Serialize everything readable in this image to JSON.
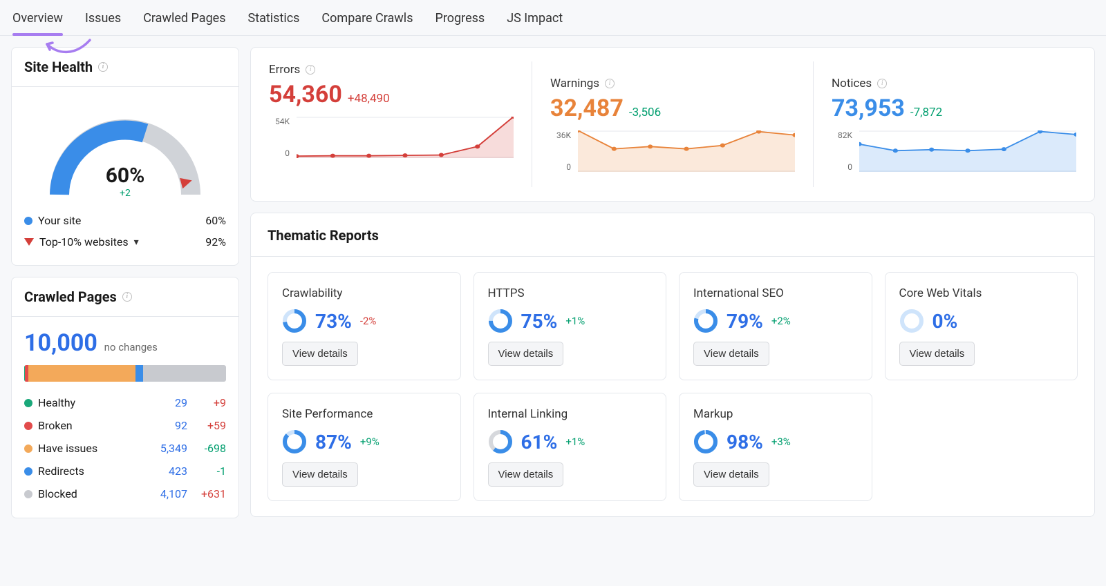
{
  "tabs": {
    "items": [
      {
        "label": "Overview",
        "active": true
      },
      {
        "label": "Issues"
      },
      {
        "label": "Crawled Pages"
      },
      {
        "label": "Statistics"
      },
      {
        "label": "Compare Crawls"
      },
      {
        "label": "Progress"
      },
      {
        "label": "JS Impact"
      }
    ]
  },
  "site_health": {
    "title": "Site Health",
    "value": "60%",
    "delta": "+2",
    "legend": {
      "your_site": {
        "label": "Your site",
        "value": "60%",
        "color": "#3a8de8"
      },
      "top10": {
        "label": "Top-10% websites",
        "value": "92%",
        "color": "#d43f3a"
      }
    }
  },
  "crawled": {
    "title": "Crawled Pages",
    "total": "10,000",
    "change_label": "no changes",
    "rows": [
      {
        "key": "healthy",
        "label": "Healthy",
        "count": "29",
        "delta": "+9",
        "delta_dir": "pos",
        "color": "#1aa87a"
      },
      {
        "key": "broken",
        "label": "Broken",
        "count": "92",
        "delta": "+59",
        "delta_dir": "pos",
        "color": "#e24b4b"
      },
      {
        "key": "issues",
        "label": "Have issues",
        "count": "5,349",
        "delta": "-698",
        "delta_dir": "neg",
        "color": "#f3a95a"
      },
      {
        "key": "redirects",
        "label": "Redirects",
        "count": "423",
        "delta": "-1",
        "delta_dir": "neg",
        "color": "#3a8de8"
      },
      {
        "key": "blocked",
        "label": "Blocked",
        "count": "4,107",
        "delta": "+631",
        "delta_dir": "pos",
        "color": "#c8cacf"
      }
    ],
    "bar_segments": [
      {
        "key": "healthy",
        "pct": 0.5,
        "color": "#1aa87a"
      },
      {
        "key": "broken",
        "pct": 1.5,
        "color": "#e24b4b"
      },
      {
        "key": "issues",
        "pct": 53,
        "color": "#f3a95a"
      },
      {
        "key": "redirects",
        "pct": 4,
        "color": "#3a8de8"
      },
      {
        "key": "blocked",
        "pct": 41,
        "color": "#c8cacf"
      }
    ]
  },
  "metrics": {
    "errors": {
      "title": "Errors",
      "value": "54,360",
      "delta": "+48,490",
      "delta_dir": "pos",
      "color": "#d43f3a",
      "y_top": "54K"
    },
    "warnings": {
      "title": "Warnings",
      "value": "32,487",
      "delta": "-3,506",
      "delta_dir": "neg",
      "color": "#e8833a",
      "y_top": "36K"
    },
    "notices": {
      "title": "Notices",
      "value": "73,953",
      "delta": "-7,872",
      "delta_dir": "neg",
      "color": "#3a8de8",
      "y_top": "82K"
    }
  },
  "thematic": {
    "title": "Thematic Reports",
    "btn_label": "View details",
    "reports": [
      {
        "key": "crawlability",
        "title": "Crawlability",
        "pct": "73%",
        "pct_num": 73,
        "delta": "-2%",
        "delta_dir": "pos"
      },
      {
        "key": "https",
        "title": "HTTPS",
        "pct": "75%",
        "pct_num": 75,
        "delta": "+1%",
        "delta_dir": "neg"
      },
      {
        "key": "intl-seo",
        "title": "International SEO",
        "pct": "79%",
        "pct_num": 79,
        "delta": "+2%",
        "delta_dir": "neg"
      },
      {
        "key": "cwv",
        "title": "Core Web Vitals",
        "pct": "0%",
        "pct_num": 0,
        "delta": "",
        "delta_dir": ""
      },
      {
        "key": "perf",
        "title": "Site Performance",
        "pct": "87%",
        "pct_num": 87,
        "delta": "+9%",
        "delta_dir": "neg"
      },
      {
        "key": "linking",
        "title": "Internal Linking",
        "pct": "61%",
        "pct_num": 61,
        "delta": "+1%",
        "delta_dir": "neg",
        "gray_track": true
      },
      {
        "key": "markup",
        "title": "Markup",
        "pct": "98%",
        "pct_num": 98,
        "delta": "+3%",
        "delta_dir": "neg"
      }
    ]
  },
  "chart_data": {
    "site_health_gauge": {
      "type": "gauge",
      "value_pct": 60,
      "marker_pct": 92,
      "title": "Site Health",
      "range": [
        0,
        100
      ]
    },
    "crawled_stacked_bar": {
      "type": "bar",
      "title": "Crawled Pages breakdown",
      "categories": [
        "Healthy",
        "Broken",
        "Have issues",
        "Redirects",
        "Blocked"
      ],
      "values": [
        29,
        92,
        5349,
        423,
        4107
      ],
      "total": 10000
    },
    "sparklines": [
      {
        "name": "Errors",
        "type": "area",
        "color": "#d43f3a",
        "ylim": [
          0,
          54000
        ],
        "x": [
          1,
          2,
          3,
          4,
          5,
          6,
          7
        ],
        "values": [
          2500,
          3000,
          3000,
          3500,
          4000,
          15000,
          54000
        ]
      },
      {
        "name": "Warnings",
        "type": "area",
        "color": "#e8833a",
        "ylim": [
          0,
          36000
        ],
        "x": [
          1,
          2,
          3,
          4,
          5,
          6,
          7
        ],
        "values": [
          36000,
          20000,
          22000,
          20000,
          23000,
          35000,
          32000
        ]
      },
      {
        "name": "Notices",
        "type": "area",
        "color": "#3a8de8",
        "ylim": [
          0,
          82000
        ],
        "x": [
          1,
          2,
          3,
          4,
          5,
          6,
          7
        ],
        "values": [
          55000,
          42000,
          44000,
          42000,
          45000,
          80000,
          74000
        ]
      }
    ],
    "thematic_donuts": {
      "type": "pie",
      "series": [
        {
          "name": "Crawlability",
          "values": [
            73,
            27
          ]
        },
        {
          "name": "HTTPS",
          "values": [
            75,
            25
          ]
        },
        {
          "name": "International SEO",
          "values": [
            79,
            21
          ]
        },
        {
          "name": "Core Web Vitals",
          "values": [
            0,
            100
          ]
        },
        {
          "name": "Site Performance",
          "values": [
            87,
            13
          ]
        },
        {
          "name": "Internal Linking",
          "values": [
            61,
            39
          ]
        },
        {
          "name": "Markup",
          "values": [
            98,
            2
          ]
        }
      ]
    }
  }
}
